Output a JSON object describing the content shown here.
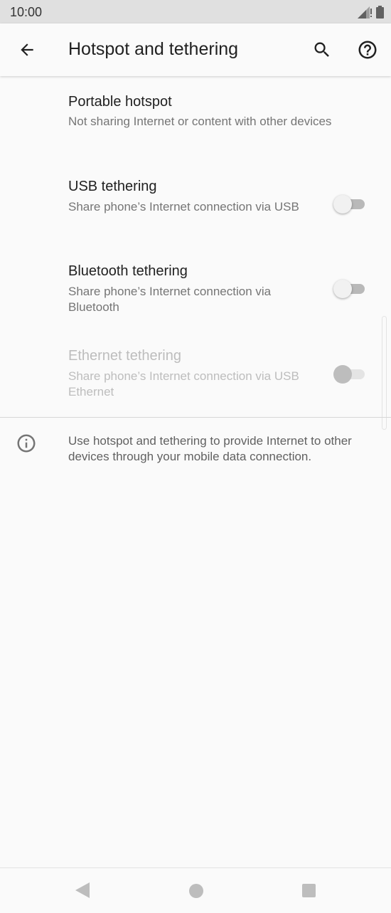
{
  "status_bar": {
    "time": "10:00"
  },
  "app_bar": {
    "title": "Hotspot and tethering",
    "back_icon": "arrow-back-icon",
    "search_icon": "search-icon",
    "help_icon": "help-circle-icon"
  },
  "preferences": [
    {
      "title": "Portable hotspot",
      "summary": "Not sharing Internet or content with other devices",
      "has_switch": false,
      "enabled": true
    },
    {
      "title": "USB tethering",
      "summary": "Share phone’s Internet connection via USB",
      "has_switch": true,
      "checked": false,
      "enabled": true
    },
    {
      "title": "Bluetooth tethering",
      "summary": "Share phone’s Internet connection via Bluetooth",
      "has_switch": true,
      "checked": false,
      "enabled": true
    },
    {
      "title": "Ethernet tethering",
      "summary": "Share phone’s Internet connection via USB Ethernet",
      "has_switch": true,
      "checked": false,
      "enabled": false
    }
  ],
  "footer": {
    "icon": "info-icon",
    "text": "Use hotspot and tethering to provide Internet to other devices through your mobile data connection."
  },
  "nav_bar": {
    "back_icon": "nav-back-triangle-icon",
    "home_icon": "nav-home-circle-icon",
    "recents_icon": "nav-recents-square-icon"
  },
  "colors": {
    "background": "#fafafa",
    "status_bar": "#e0e0e0",
    "title_text": "#212121",
    "summary_text": "#757575",
    "disabled_text": "#bdbdbd"
  }
}
